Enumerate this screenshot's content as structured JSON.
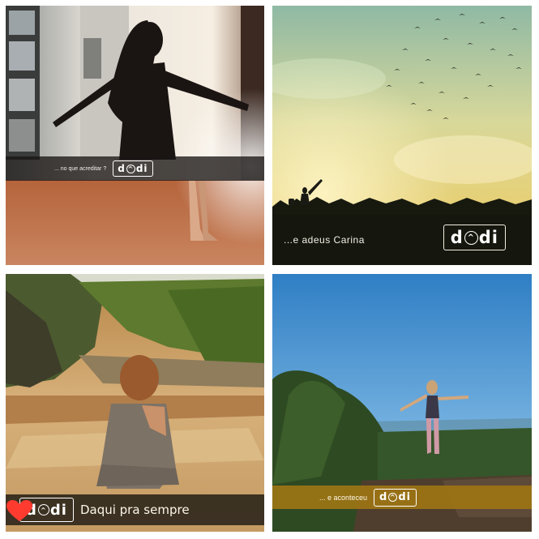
{
  "brand": {
    "logo_text": "dOdi",
    "colors": {
      "gold_bar": "#9e7614",
      "dark_bar": "#15170e",
      "heart": "#ff3b30"
    }
  },
  "tiles": [
    {
      "caption": "... no que acreditar ?",
      "photo": "woman-at-window-barefoot-on-dirt"
    },
    {
      "caption": "...e adeus Carina",
      "photo": "sunset-sky-birds-silhouette-girl"
    },
    {
      "caption": "Daqui pra sempre",
      "photo": "woman-sitting-on-rocky-riverbed",
      "icon": "heart-icon"
    },
    {
      "caption": "... e aconteceu",
      "photo": "woman-arms-open-on-cliff-blue-sky"
    }
  ]
}
